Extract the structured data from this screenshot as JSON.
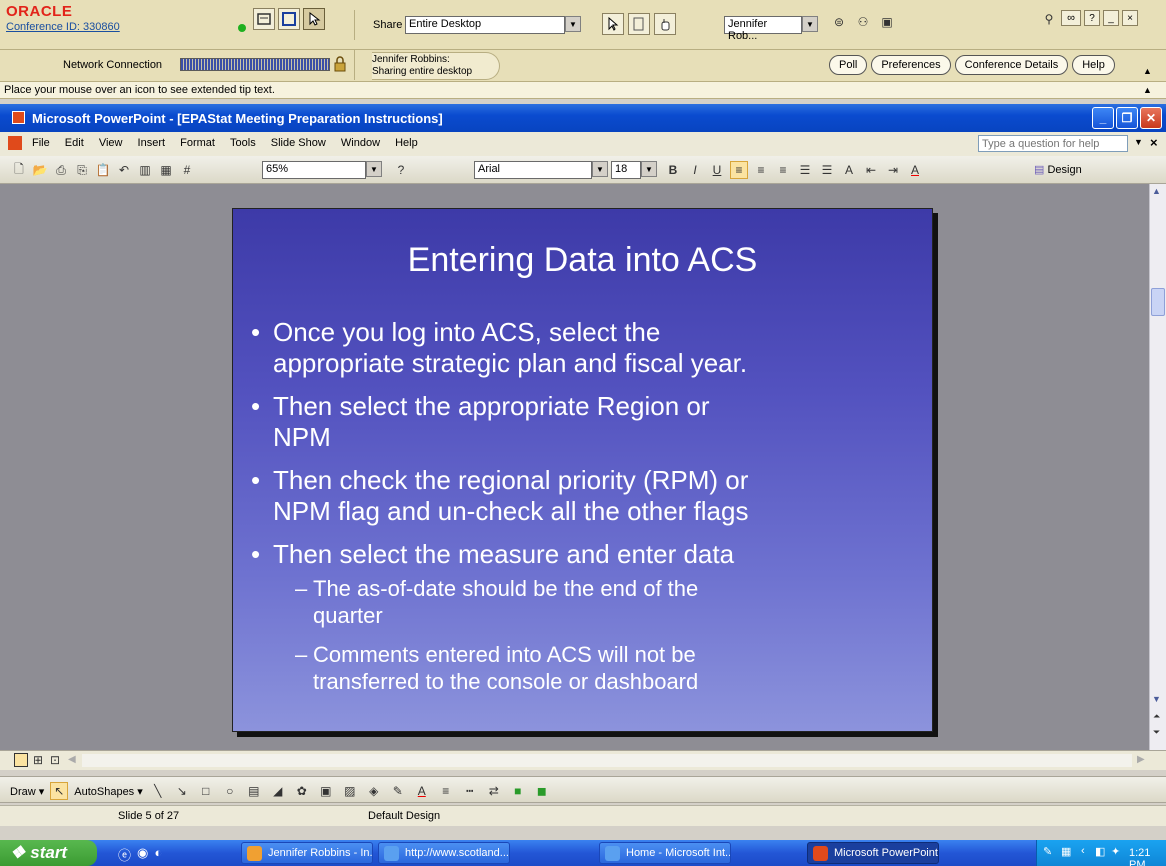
{
  "conference": {
    "logo": "ORACLE",
    "conference_id": "Conference ID: 330860",
    "network_label": "Network Connection",
    "share_label": "Share",
    "share_value": "Entire Desktop",
    "presenter_select": "Jennifer Rob...",
    "presenter_status_line1": "Jennifer Robbins:",
    "presenter_status_line2": "Sharing entire desktop",
    "buttons": [
      "Poll",
      "Preferences",
      "Conference Details",
      "Help"
    ],
    "tip_text": "Place your mouse over an icon to see extended tip text."
  },
  "powerpoint": {
    "window_title": "Microsoft PowerPoint - [EPAStat Meeting Preparation Instructions]",
    "menu": [
      "File",
      "Edit",
      "View",
      "Insert",
      "Format",
      "Tools",
      "Slide Show",
      "Window",
      "Help"
    ],
    "help_placeholder": "Type a question for help",
    "zoom": "65%",
    "font": "Arial",
    "font_size": "18",
    "design_label": "Design",
    "draw_label": "Draw",
    "autoshapes_label": "AutoShapes",
    "status_slide": "Slide 5 of 27",
    "status_design": "Default Design"
  },
  "slide": {
    "title": "Entering Data into ACS",
    "bullets": [
      {
        "line1": "Once you log into ACS, select the",
        "line2": "appropriate strategic plan and fiscal year."
      },
      {
        "line1": "Then select the appropriate Region or",
        "line2": "NPM"
      },
      {
        "line1": "Then check the regional priority (RPM) or",
        "line2": "NPM flag and un-check all the other flags"
      },
      {
        "line1": "Then select the measure and enter data",
        "line2": ""
      }
    ],
    "sub_bullets": [
      {
        "line1": "The as-of-date should be the end of the",
        "line2": "quarter"
      },
      {
        "line1": "Comments entered into ACS will not be",
        "line2": "transferred to the console or dashboard"
      }
    ]
  },
  "taskbar": {
    "start": "start",
    "tasks": [
      "Jennifer Robbins - In...",
      "http://www.scotland...",
      "Home - Microsoft Int...",
      "Microsoft PowerPoint..."
    ],
    "clock": "1:21 PM"
  },
  "colors": {
    "slide_top": "#3d3aa8",
    "slide_bottom": "#8c93dc",
    "xp_title_blue": "#0a4bcf",
    "oracle_red": "#e2231a"
  }
}
